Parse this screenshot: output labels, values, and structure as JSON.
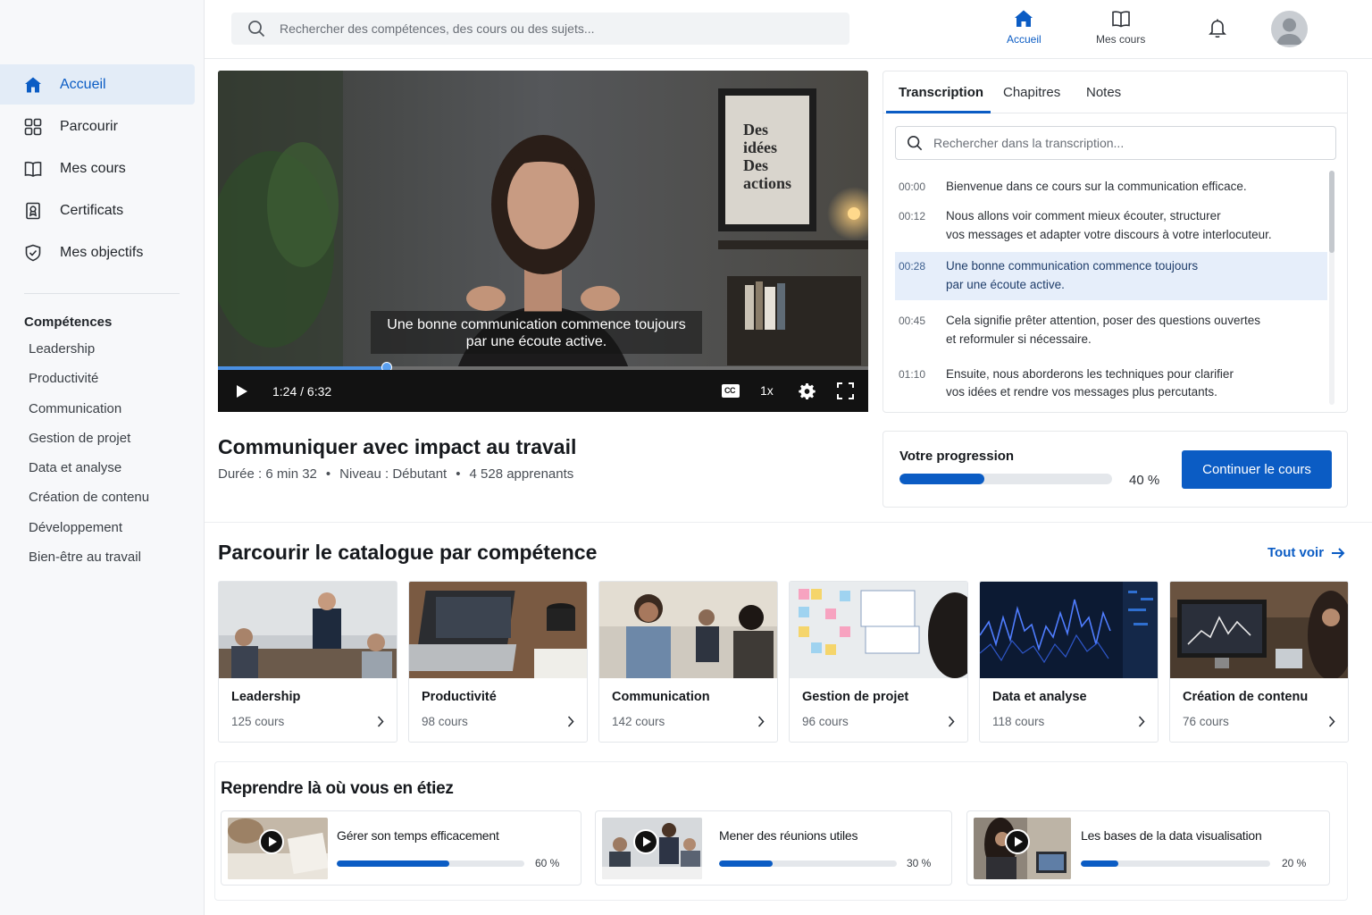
{
  "sidebar": {
    "nav": [
      {
        "label": "Accueil",
        "icon": "home-icon"
      },
      {
        "label": "Parcourir",
        "icon": "grid-icon"
      },
      {
        "label": "Mes cours",
        "icon": "book-icon"
      },
      {
        "label": "Certificats",
        "icon": "certificate-icon"
      },
      {
        "label": "Mes objectifs",
        "icon": "target-check-icon"
      }
    ],
    "skills_title": "Compétences",
    "skills": [
      "Leadership",
      "Productivité",
      "Communication",
      "Gestion de projet",
      "Data et analyse",
      "Création de contenu",
      "Développement",
      "Bien-être au travail"
    ]
  },
  "header": {
    "search_placeholder": "Rechercher des compétences, des cours ou des sujets...",
    "nav_home": "Accueil",
    "nav_courses": "Mes cours"
  },
  "video": {
    "caption_line1": "Une bonne communication commence toujours",
    "caption_line2": "par une écoute active.",
    "time": "1:24 / 6:32",
    "progress": 0.26,
    "speed": "1x",
    "cc": "CC",
    "poster_text": [
      "Des",
      "idées",
      "Des",
      "actions"
    ]
  },
  "panel": {
    "tabs": [
      "Transcription",
      "Chapitres",
      "Notes"
    ],
    "search_placeholder": "Rechercher dans la transcription...",
    "transcript": [
      {
        "time": "00:00",
        "line1": "Bienvenue dans ce cours sur la communication efficace.",
        "line2": ""
      },
      {
        "time": "00:12",
        "line1": "Nous allons voir comment mieux écouter, structurer",
        "line2": "vos messages et adapter votre discours à votre interlocuteur."
      },
      {
        "time": "00:28",
        "line1": "Une bonne communication commence toujours",
        "line2": "par une écoute active."
      },
      {
        "time": "00:45",
        "line1": "Cela signifie prêter attention, poser des questions ouvertes",
        "line2": "et reformuler si nécessaire."
      },
      {
        "time": "01:10",
        "line1": "Ensuite, nous aborderons les techniques pour clarifier",
        "line2": "vos idées et rendre vos messages plus percutants."
      }
    ]
  },
  "course": {
    "title": "Communiquer avec impact au travail",
    "duration": "Durée : 6 min 32",
    "level": "Niveau : Débutant",
    "learners": "4 528 apprenants"
  },
  "progress": {
    "label": "Votre progression",
    "value": 0.4,
    "pct_text": "40 %",
    "button": "Continuer le cours"
  },
  "catalog": {
    "title": "Parcourir le catalogue par compétence",
    "see_all": "Tout voir",
    "cards": [
      {
        "name": "Leadership",
        "count": "125 cours"
      },
      {
        "name": "Productivité",
        "count": "98 cours"
      },
      {
        "name": "Communication",
        "count": "142 cours"
      },
      {
        "name": "Gestion de projet",
        "count": "96 cours"
      },
      {
        "name": "Data et analyse",
        "count": "118 cours"
      },
      {
        "name": "Création de contenu",
        "count": "76 cours"
      }
    ]
  },
  "resume": {
    "title": "Reprendre là où vous en étiez",
    "items": [
      {
        "name": "Gérer son temps efficacement",
        "value": 0.6,
        "pct_text": "60 %"
      },
      {
        "name": "Mener des réunions utiles",
        "value": 0.3,
        "pct_text": "30 %"
      },
      {
        "name": "Les bases de la data visualisation",
        "value": 0.2,
        "pct_text": "20 %"
      }
    ]
  },
  "colors": {
    "accent": "#0b5cc4",
    "active_bg": "#e3ecf7",
    "highlight": "#e6eefa"
  }
}
